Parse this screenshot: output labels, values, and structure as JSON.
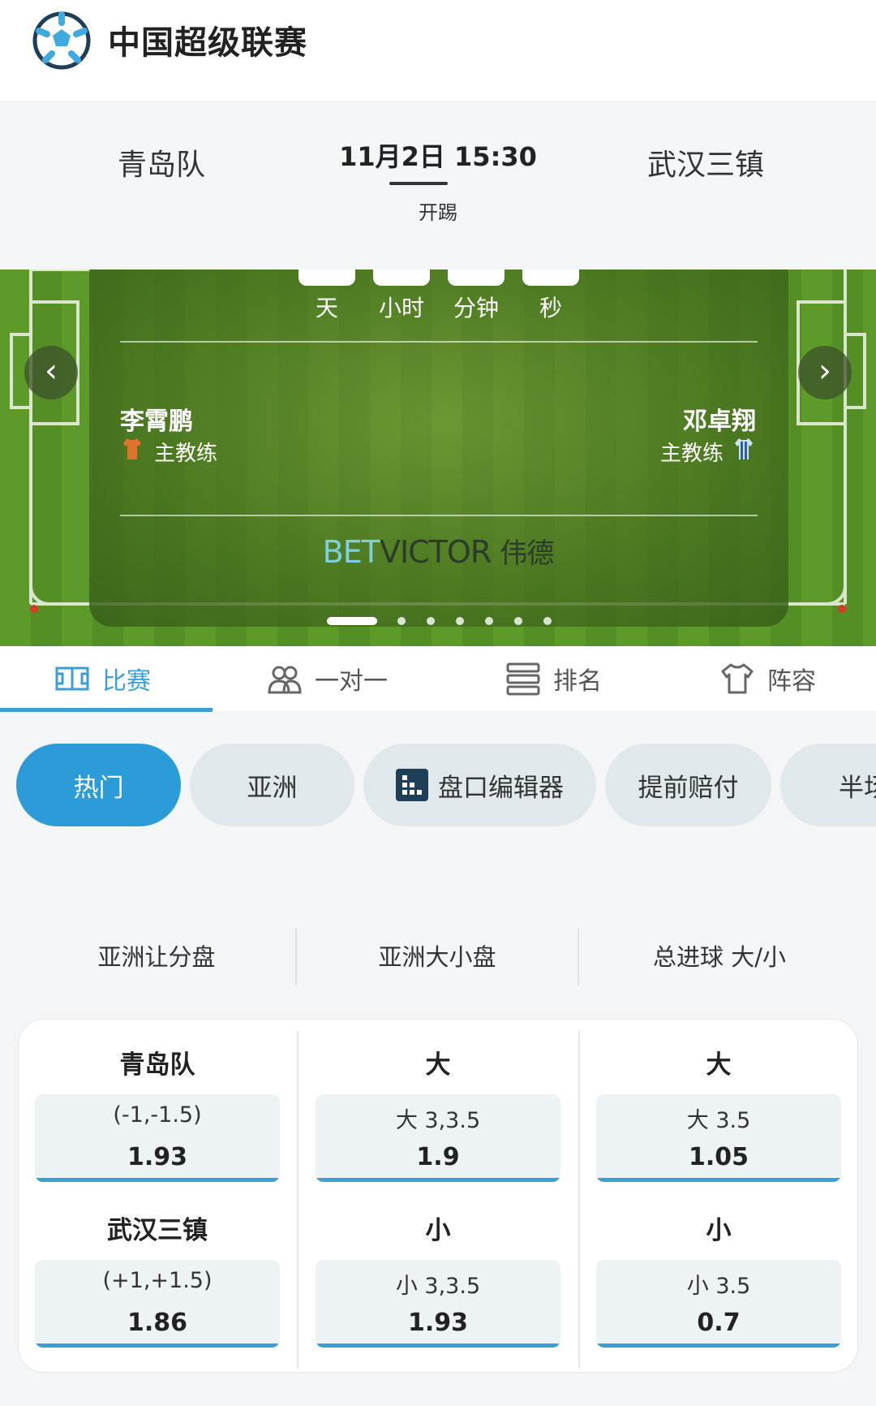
{
  "header": {
    "title": "中国超级联赛",
    "logo_icon": "soccer-ball-icon"
  },
  "match": {
    "home_team": "青岛队",
    "away_team": "武汉三镇",
    "kickoff_time": "11月2日 15:30",
    "kickoff_label": "开踢"
  },
  "countdown": {
    "labels": [
      "天",
      "小时",
      "分钟",
      "秒"
    ]
  },
  "coaches": {
    "home": {
      "name": "李霄鹏",
      "role": "主教练",
      "shirt_color": "#e0722c"
    },
    "away": {
      "name": "邓卓翔",
      "role": "主教练",
      "shirt_color": "#2a5fb0"
    }
  },
  "sponsor": {
    "bet": "BET",
    "victor": "VICTOR",
    "cn": "伟德"
  },
  "carousel": {
    "slides": 7,
    "active": 0
  },
  "tabs": [
    {
      "label": "比赛",
      "icon": "pitch-icon",
      "active": true
    },
    {
      "label": "一对一",
      "icon": "users-icon",
      "active": false
    },
    {
      "label": "排名",
      "icon": "list-icon",
      "active": false
    },
    {
      "label": "阵容",
      "icon": "shirt-icon",
      "active": false
    }
  ],
  "chips": [
    {
      "label": "热门",
      "active": true
    },
    {
      "label": "亚洲",
      "active": false
    },
    {
      "label": "盘口编辑器",
      "active": false,
      "icon": "grid-icon"
    },
    {
      "label": "提前赔付",
      "active": false
    },
    {
      "label": "半场",
      "active": false
    }
  ],
  "markets": {
    "headers": [
      "亚洲让分盘",
      "亚洲大小盘",
      "总进球 大/小"
    ],
    "columns": [
      {
        "rows": [
          {
            "label": "青岛队",
            "line": "(-1,-1.5)",
            "price": "1.93"
          },
          {
            "label": "武汉三镇",
            "line": "(+1,+1.5)",
            "price": "1.86"
          }
        ]
      },
      {
        "rows": [
          {
            "label": "大",
            "line": "大 3,3.5",
            "price": "1.9"
          },
          {
            "label": "小",
            "line": "小 3,3.5",
            "price": "1.93"
          }
        ]
      },
      {
        "rows": [
          {
            "label": "大",
            "line": "大 3.5",
            "price": "1.05"
          },
          {
            "label": "小",
            "line": "小 3.5",
            "price": "0.7"
          }
        ]
      }
    ]
  },
  "colors": {
    "accent": "#3a9fd6",
    "chip_active": "#2b9cd7",
    "chip_bg": "#e1e8ec",
    "pitch": "#5e9a2a"
  }
}
